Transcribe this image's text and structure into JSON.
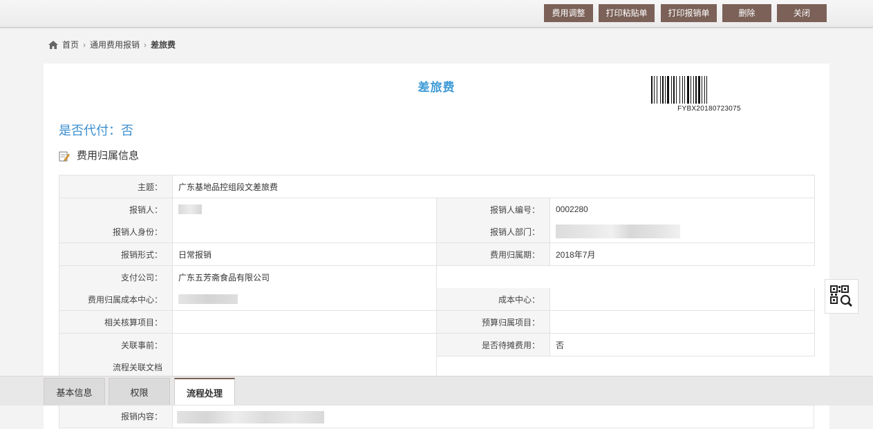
{
  "toolbar": {
    "adjust": "费用调整",
    "print_sticker": "打印粘贴单",
    "print_report": "打印报销单",
    "delete": "删除",
    "close": "关闭"
  },
  "breadcrumb": {
    "home": "首页",
    "level1": "通用费用报销",
    "current": "差旅费"
  },
  "form": {
    "title": "差旅费",
    "barcode": "FYBX20180723075",
    "proxy_pay": "是否代付：否",
    "section_title": "费用归属信息"
  },
  "fields": {
    "subject_label": "主题：",
    "subject_value": "广东基地品控组段文差旅费",
    "reporter_label": "报销人：",
    "reporter_no_label": "报销人编号：",
    "reporter_no_value": "0002280",
    "reporter_id_label": "报销人身份：",
    "reporter_dept_label": "报销人部门：",
    "form_type_label": "报销形式：",
    "form_type_value": "日常报销",
    "period_label": "费用归属期：",
    "period_value": "2018年7月",
    "company_label": "支付公司：",
    "company_value": "广东五芳斋食品有限公司",
    "cost_center_owner_label": "费用归属成本中心：",
    "cost_center_label": "成本中心：",
    "acct_item_label": "相关核算项目：",
    "budget_item_label": "预算归属项目：",
    "prior_label": "关联事前：",
    "pending_label": "是否待摊费用：",
    "pending_value": "否",
    "docs_label": "流程关联文档"
  },
  "tabs": {
    "basic": "基本信息",
    "perm": "权限",
    "flow": "流程处理"
  },
  "bottom": {
    "content_label": "报销内容："
  },
  "colors": {
    "button": "#7b6158",
    "title": "#3e9bd6"
  }
}
